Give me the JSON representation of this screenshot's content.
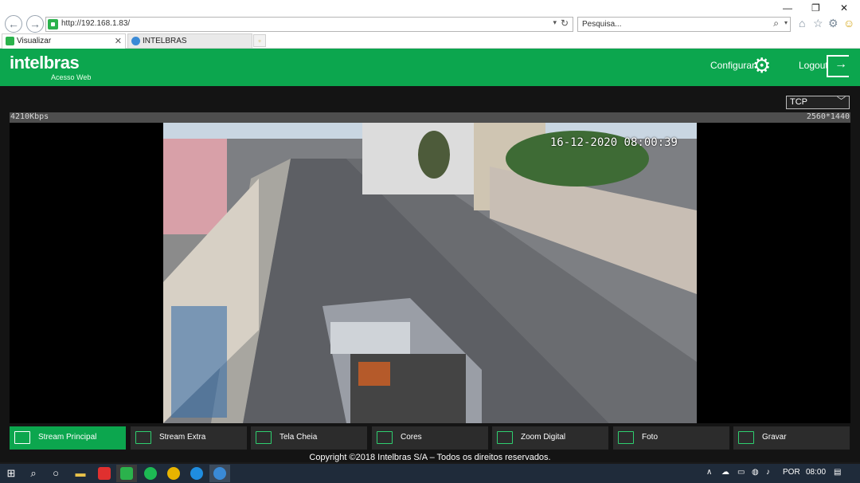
{
  "browser": {
    "url": "http://192.168.1.83/",
    "search_placeholder": "Pesquisa...",
    "tabs": [
      {
        "label": "Visualizar"
      },
      {
        "label": "INTELBRAS"
      }
    ]
  },
  "header": {
    "logo": "intelbras",
    "logo_sub": "Acesso Web",
    "config_label": "Configurar",
    "logout_label": "Logout"
  },
  "stream": {
    "protocol": "TCP",
    "bitrate": "4210Kbps",
    "resolution": "2560*1440",
    "timestamp": "16-12-2020 08:00:39"
  },
  "toolbar": {
    "buttons": [
      {
        "label": "Stream Principal",
        "icon": "image-icon"
      },
      {
        "label": "Stream Extra",
        "icon": "image-icon"
      },
      {
        "label": "Tela Cheia",
        "icon": "fullscreen-icon"
      },
      {
        "label": "Cores",
        "icon": "palette-icon"
      },
      {
        "label": "Zoom Digital",
        "icon": "zoom-icon"
      },
      {
        "label": "Foto",
        "icon": "camera-icon"
      },
      {
        "label": "Gravar",
        "icon": "video-icon"
      }
    ]
  },
  "footer": {
    "copyright": "Copyright ©2018 Intelbras S/A – Todos os direitos reservados."
  },
  "taskbar": {
    "language": "POR",
    "time": "08:00"
  },
  "colors": {
    "brand_green": "#0ca64e",
    "toolbar_dark": "#2c2c2c"
  }
}
